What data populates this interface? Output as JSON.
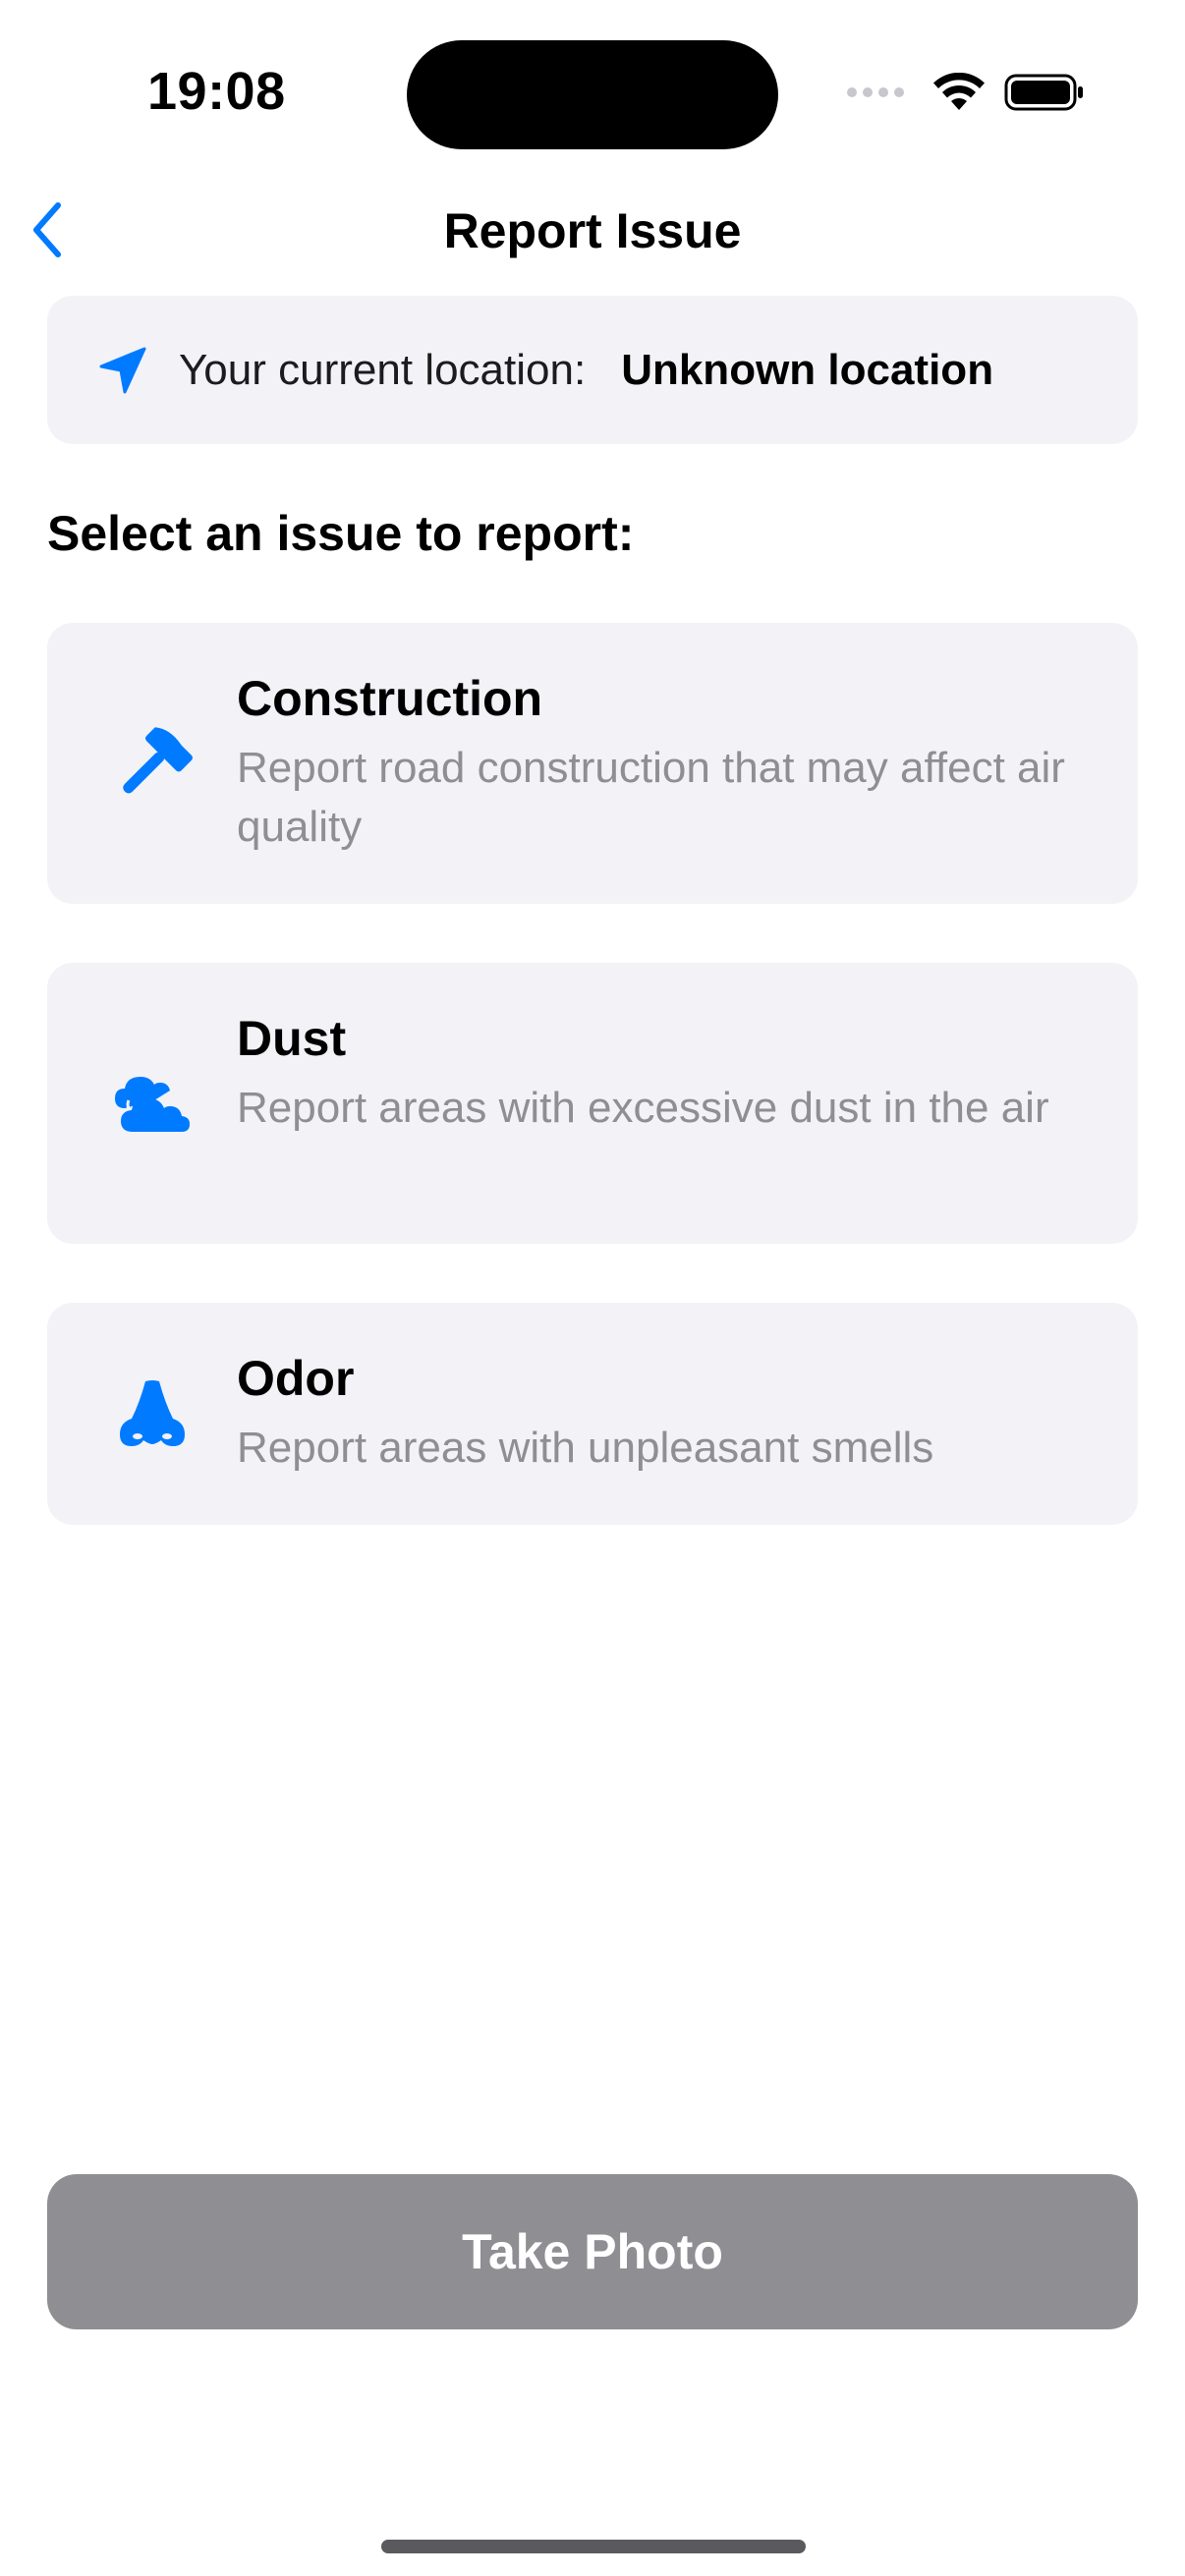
{
  "status_bar": {
    "time": "19:08"
  },
  "nav": {
    "title": "Report Issue"
  },
  "location": {
    "label": "Your current location:",
    "value": "Unknown location"
  },
  "section_heading": "Select an issue to report:",
  "issues": [
    {
      "title": "Construction",
      "description": "Report road construction that may affect air quality",
      "icon": "hammer-icon"
    },
    {
      "title": "Dust",
      "description": "Report areas with excessive dust in the air",
      "icon": "cloud-icon"
    },
    {
      "title": "Odor",
      "description": "Report areas with unpleasant smells",
      "icon": "nose-icon"
    }
  ],
  "actions": {
    "take_photo_label": "Take Photo"
  },
  "colors": {
    "accent": "#007aff",
    "card_background": "#f2f2f7",
    "secondary_text": "#8e8e93",
    "button_disabled": "#8e8e93"
  }
}
